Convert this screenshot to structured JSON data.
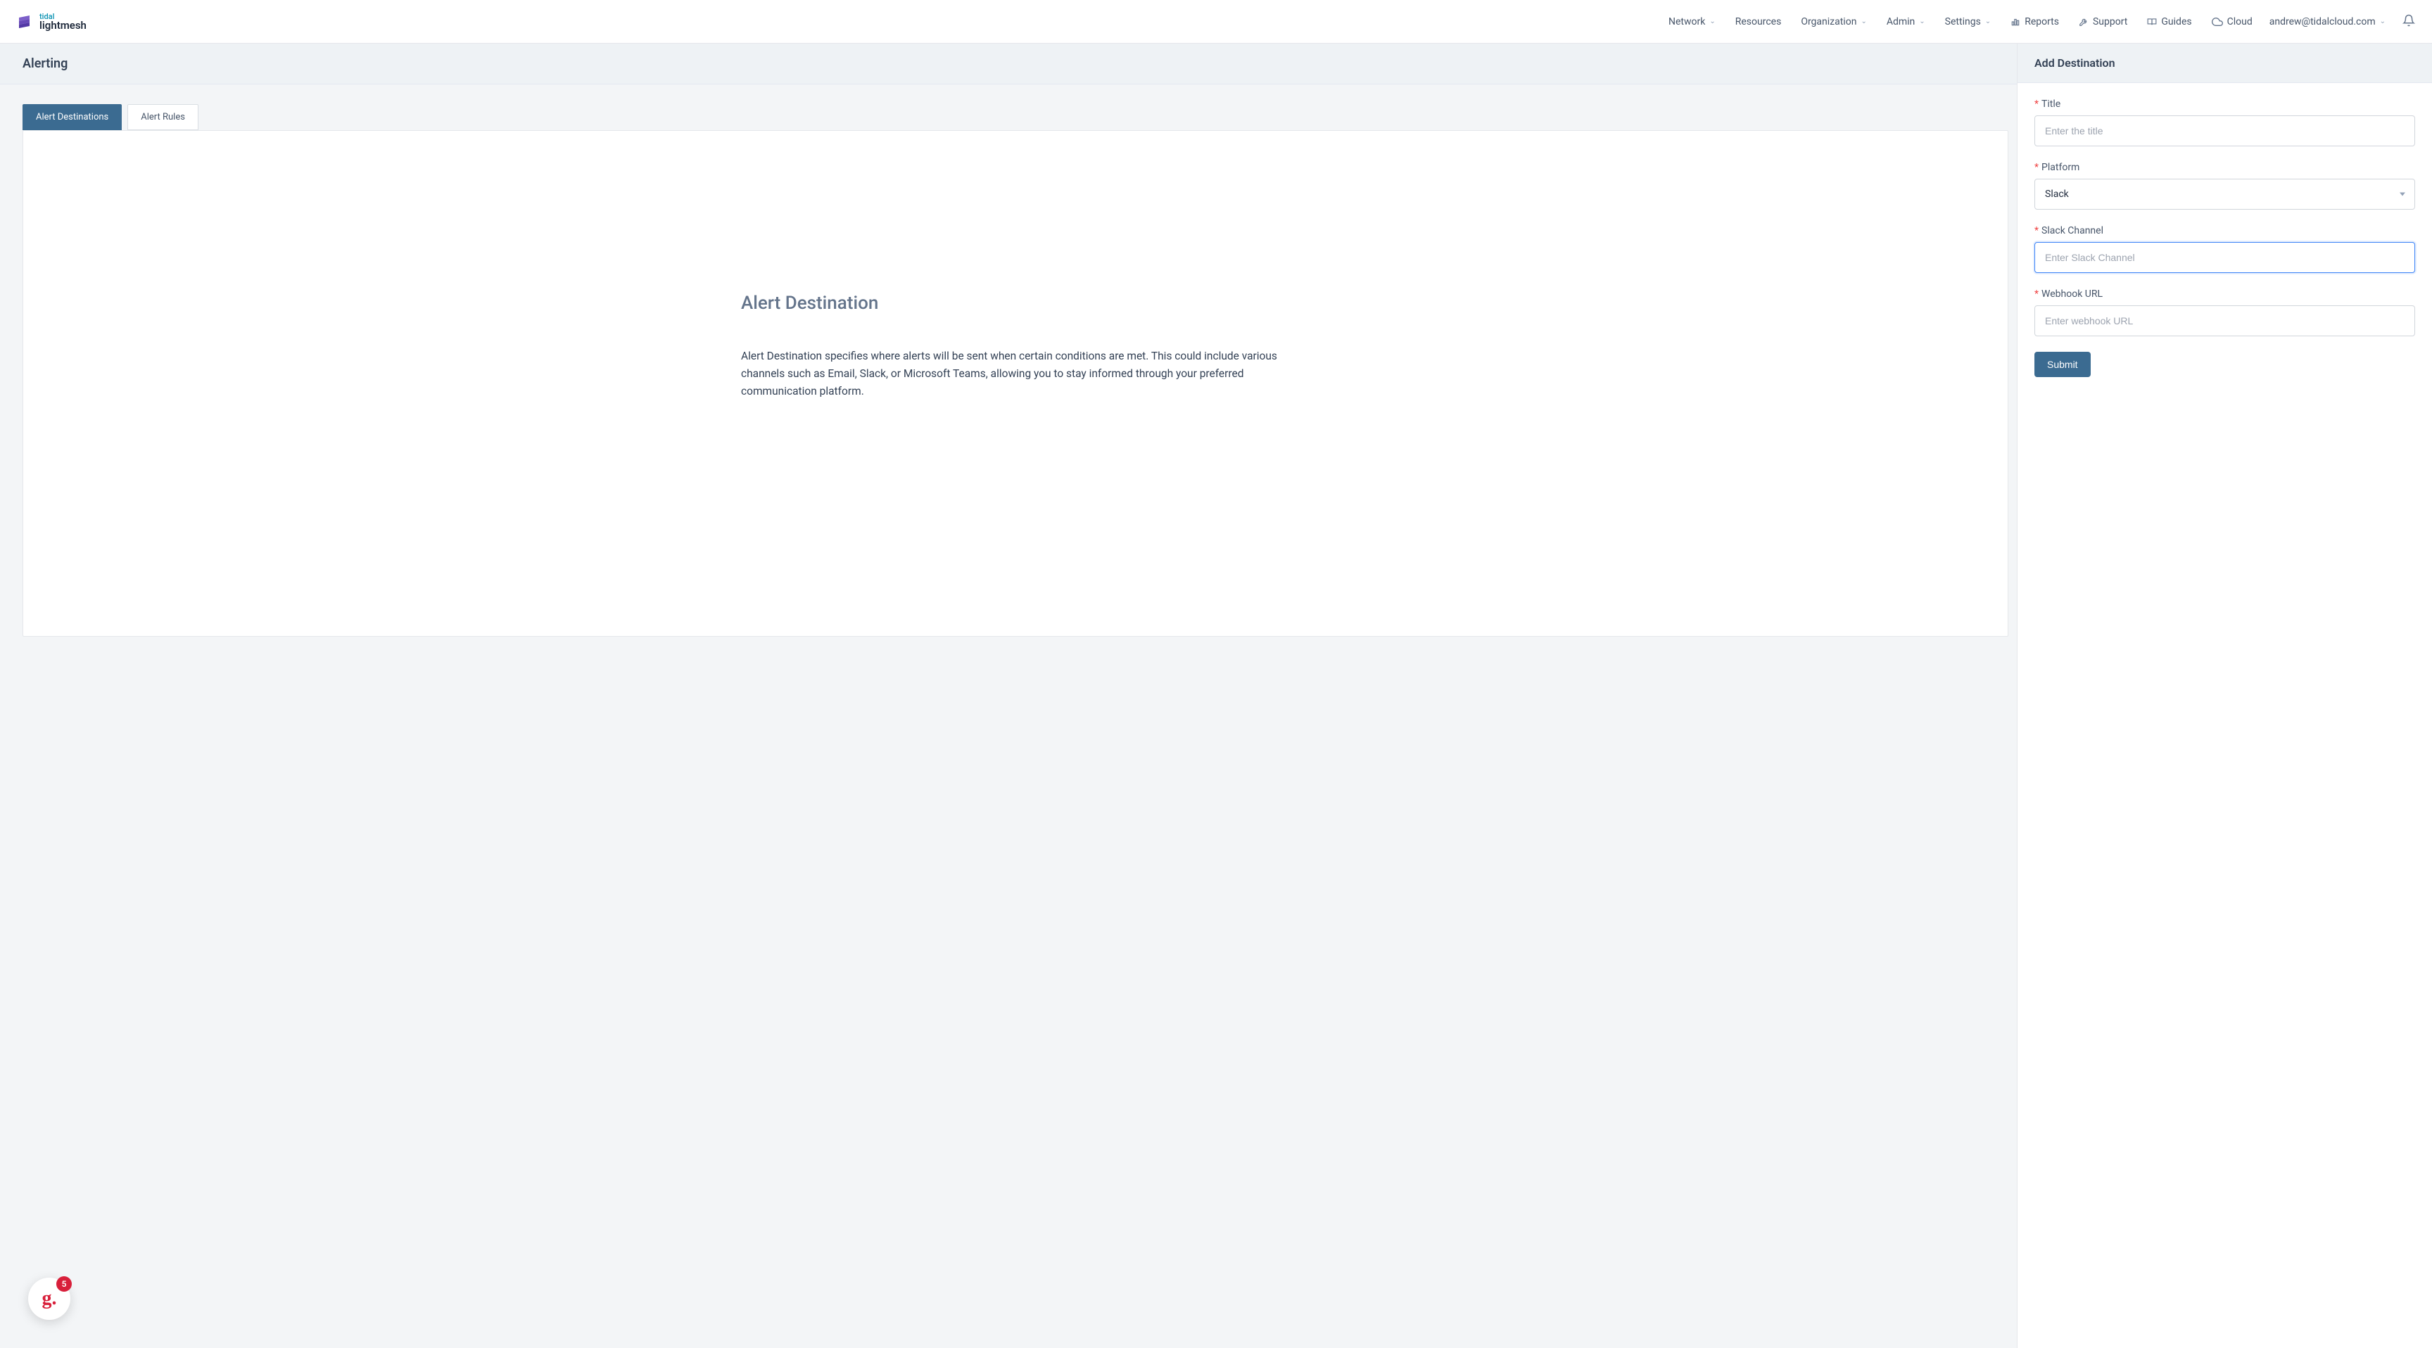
{
  "logo": {
    "top": "tidal",
    "bottom": "lightmesh"
  },
  "nav": {
    "network": "Network",
    "resources": "Resources",
    "organization": "Organization",
    "admin": "Admin",
    "settings": "Settings",
    "reports": "Reports",
    "support": "Support",
    "guides": "Guides",
    "cloud": "Cloud",
    "user_email": "andrew@tidalcloud.com"
  },
  "page": {
    "title": "Alerting"
  },
  "tabs": {
    "destinations": "Alert Destinations",
    "rules": "Alert Rules"
  },
  "content": {
    "heading": "Alert Destination",
    "description": "Alert Destination specifies where alerts will be sent when certain conditions are met. This could include various channels such as Email, Slack, or Microsoft Teams, allowing you to stay informed through your preferred communication platform."
  },
  "panel": {
    "title": "Add Destination",
    "fields": {
      "title": {
        "label": "Title",
        "placeholder": "Enter the title",
        "value": ""
      },
      "platform": {
        "label": "Platform",
        "value": "Slack"
      },
      "slack_channel": {
        "label": "Slack Channel",
        "placeholder": "Enter Slack Channel",
        "value": ""
      },
      "webhook": {
        "label": "Webhook URL",
        "placeholder": "Enter webhook URL",
        "value": ""
      }
    },
    "submit": "Submit"
  },
  "help": {
    "badge_count": "5",
    "glyph": "g."
  }
}
